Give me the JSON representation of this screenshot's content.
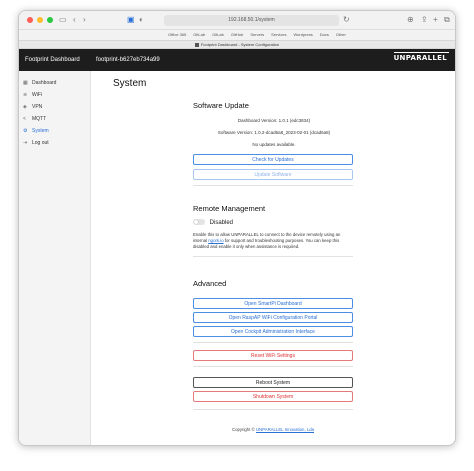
{
  "browser": {
    "url": "192.168.50.1/system",
    "bookmarks": [
      "Office 365",
      "GitLab",
      "GitLab",
      "GitHub",
      "Servers",
      "Services",
      "Wordpress",
      "Docs",
      "Other"
    ],
    "tab_title": "Footprint Dashboard - System Configuration"
  },
  "header": {
    "brand": "Footprint Dashboard",
    "device": "footprint-b627eb734a99",
    "logo": "UNPARALLEL"
  },
  "sidebar": {
    "items": [
      {
        "label": "Dashboard",
        "icon": "grid-icon"
      },
      {
        "label": "WiFi",
        "icon": "wifi-icon"
      },
      {
        "label": "VPN",
        "icon": "shield-icon"
      },
      {
        "label": "MQTT",
        "icon": "share-icon"
      },
      {
        "label": "System",
        "icon": "gear-icon"
      },
      {
        "label": "Log out",
        "icon": "logout-icon"
      }
    ],
    "active": "System"
  },
  "page": {
    "title": "System",
    "software_update": {
      "title": "Software Update",
      "dashboard_version": "Dashboard Version: 1.0.1 (edc3834)",
      "software_version": "Software Version: 1.0.2-dcad6a8_2023-02-01 (dcad6a8)",
      "status": "No updates available.",
      "check_label": "Check for Updates",
      "update_label": "Update Software"
    },
    "remote": {
      "title": "Remote Management",
      "toggle_label": "Disabled",
      "desc_pre": "Enable this to allow UNPARALLEL to connect to the device remotely using an internal ",
      "desc_link": "ngork.io",
      "desc_post": " for support and troubleshooting purposes. You can keep this disabled and enable it only when assistance is required."
    },
    "advanced": {
      "title": "Advanced",
      "smartpi_label": "Open SmartPi Dashboard",
      "raspap_label": "Open RaspAP WiFi Configuration Portal",
      "cockpit_label": "Open Cockpit Administration Interface",
      "reset_wifi_label": "Reset WiFi Settings",
      "reboot_label": "Reboot System",
      "shutdown_label": "Shutdown System"
    },
    "footer": {
      "prefix": "Copyright © ",
      "link": "UNPARALLEL Innovation, Lda"
    }
  }
}
